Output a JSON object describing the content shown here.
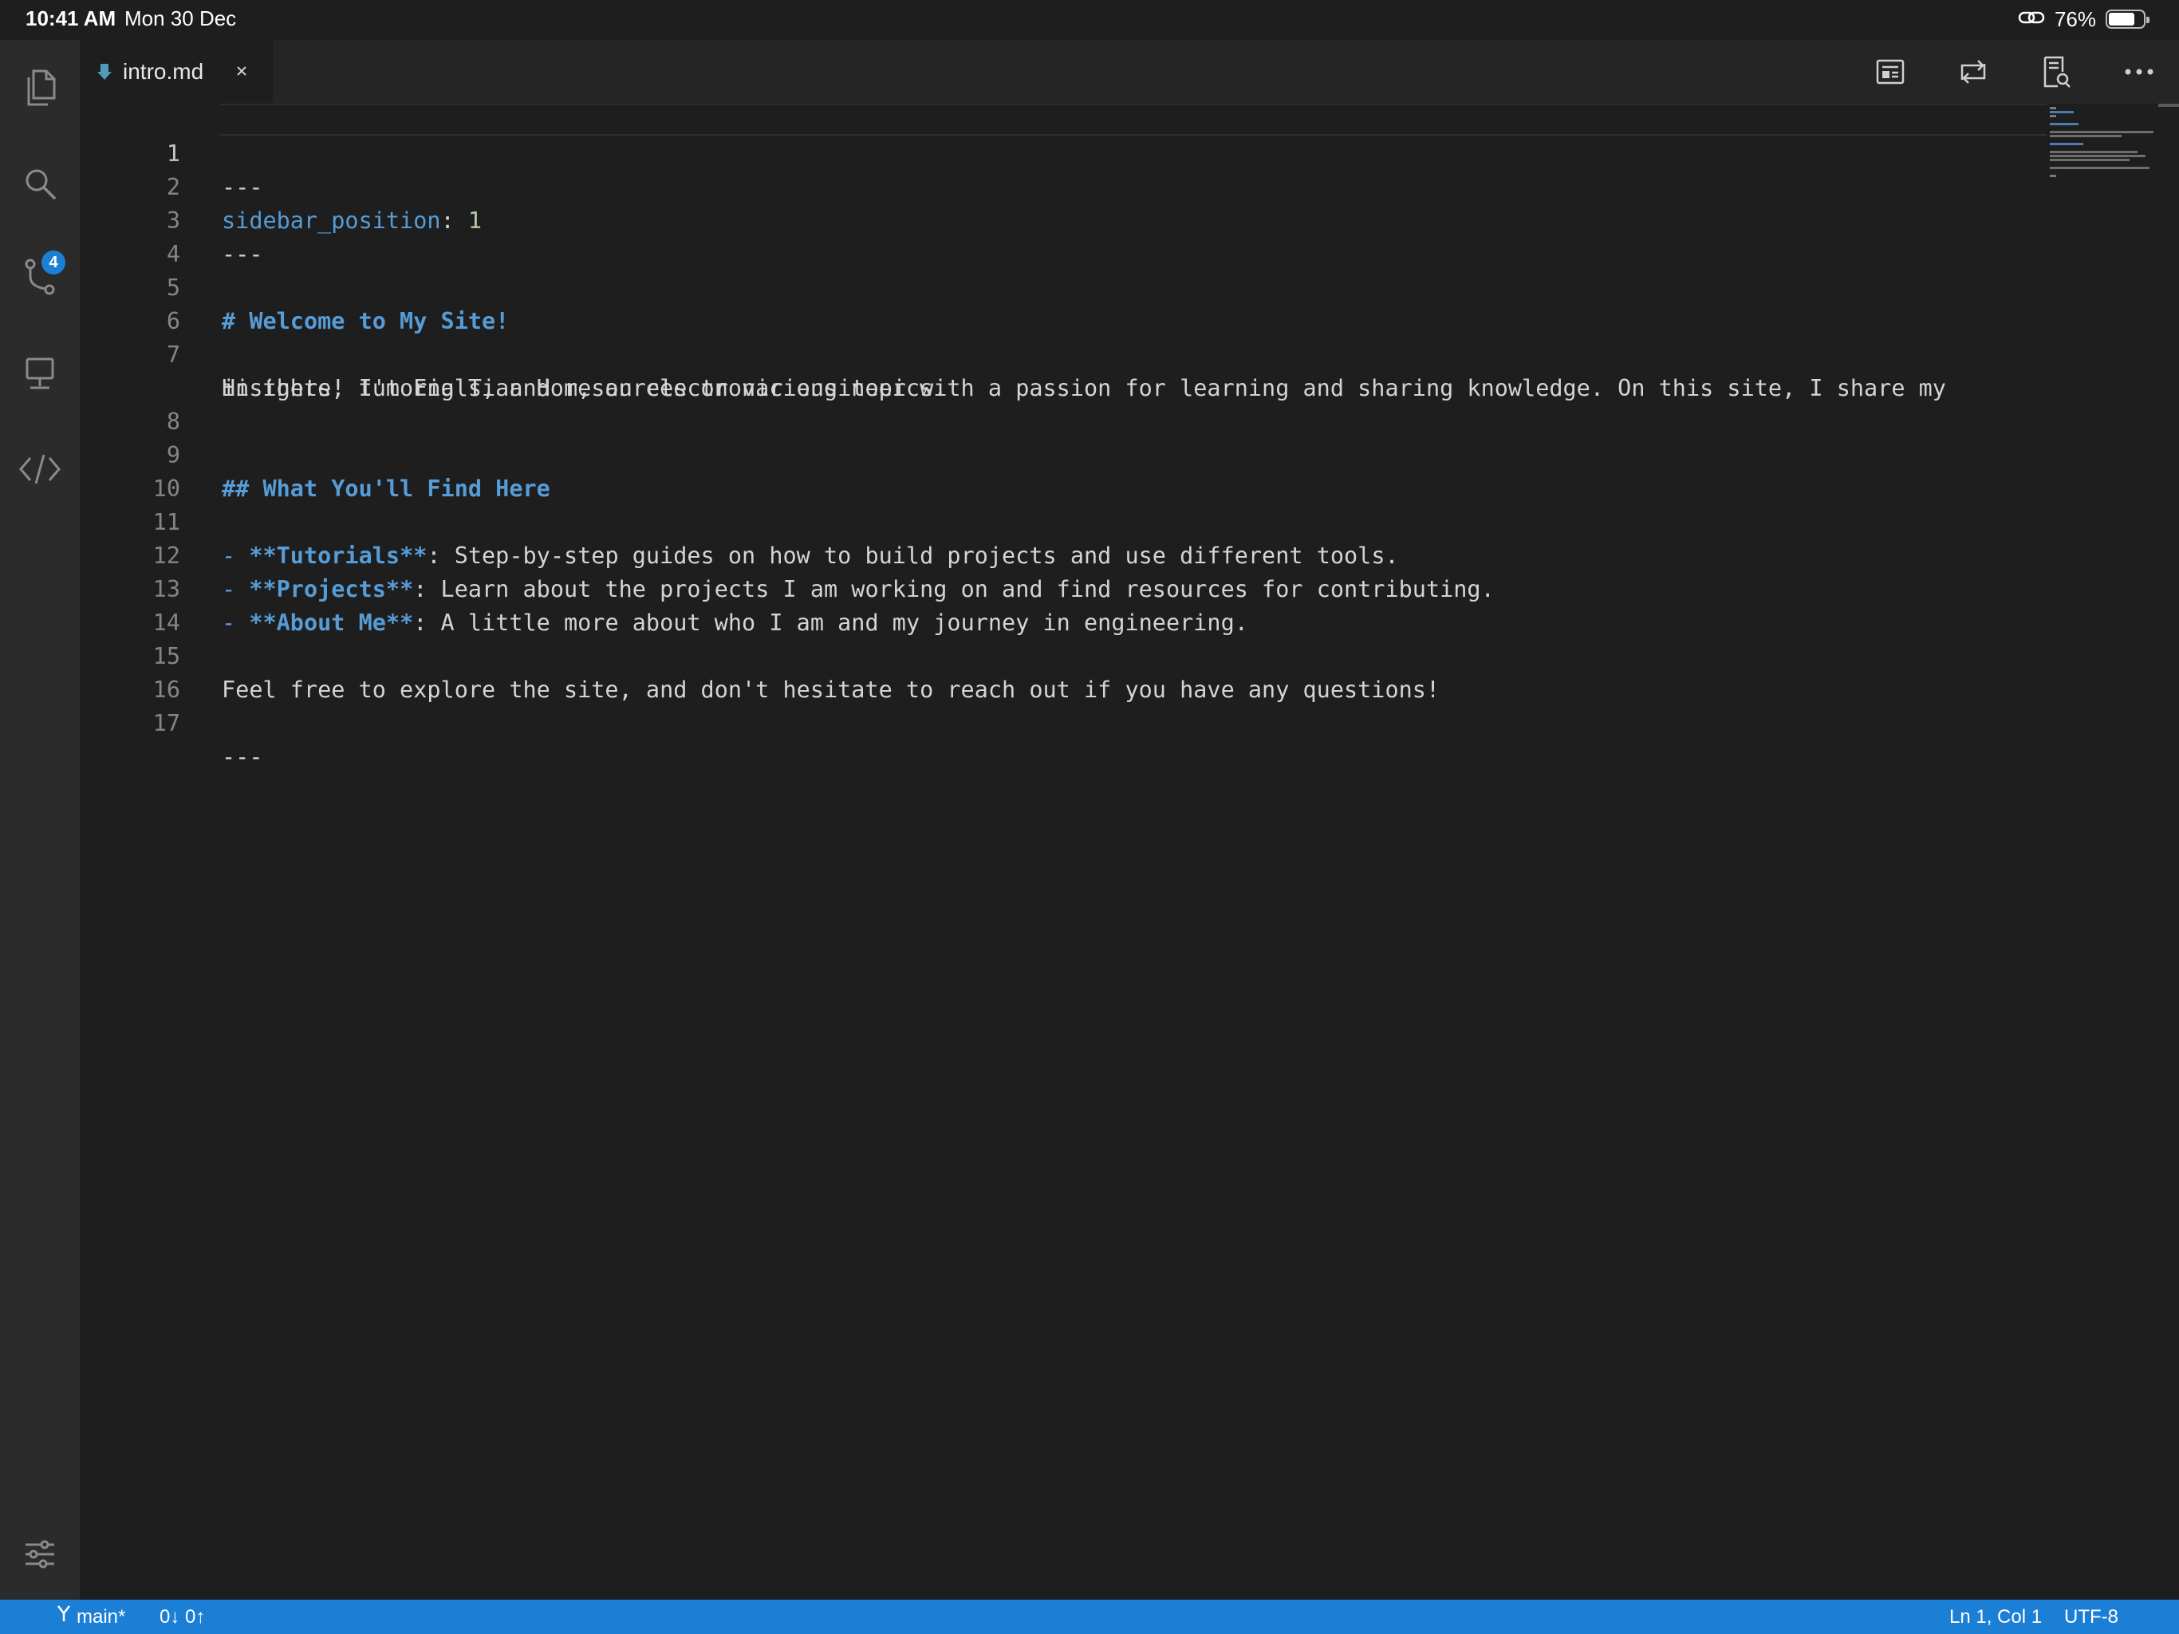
{
  "system_status": {
    "time": "10:41 AM",
    "date": "Mon 30 Dec",
    "battery_percent": "76%",
    "battery_level": 0.76
  },
  "activity_bar": {
    "items": [
      {
        "name": "explorer",
        "icon": "files-icon"
      },
      {
        "name": "search",
        "icon": "search-icon"
      },
      {
        "name": "source-control",
        "icon": "source-control-icon",
        "badge": "4"
      },
      {
        "name": "remote-explorer",
        "icon": "remote-explorer-icon"
      },
      {
        "name": "code",
        "icon": "code-icon"
      }
    ],
    "settings_icon": "settings-sliders-icon"
  },
  "tabs": [
    {
      "label": "intro.md",
      "active": true,
      "icon": "markdown-file-icon"
    }
  ],
  "toolbar": {
    "actions": [
      "open-preview-icon",
      "compare-changes-icon",
      "search-preview-icon",
      "more-actions-icon"
    ]
  },
  "editor": {
    "active_line": 1,
    "lines": [
      {
        "n": "1",
        "t": "---"
      },
      {
        "n": "2",
        "k": "sidebar_position",
        "sep": ": ",
        "v": "1"
      },
      {
        "n": "3",
        "t": "---"
      },
      {
        "n": "4",
        "t": ""
      },
      {
        "n": "5",
        "h": "# Welcome to My Site!"
      },
      {
        "n": "6",
        "t": ""
      },
      {
        "n": "7",
        "t": "Hi there! I'm Eng Tian Hom, an electronic engineer with a passion for learning and sharing knowledge. On this site, I share my",
        "t2": "insights, tutorials, and resources on various topics."
      },
      {
        "n": "8",
        "t": ""
      },
      {
        "n": "9",
        "h": "## What You'll Find Here"
      },
      {
        "n": "10",
        "t": ""
      },
      {
        "n": "11",
        "b": "- ",
        "bold": "**Tutorials**",
        "rest": ": Step-by-step guides on how to build projects and use different tools."
      },
      {
        "n": "12",
        "b": "- ",
        "bold": "**Projects**",
        "rest": ": Learn about the projects I am working on and find resources for contributing."
      },
      {
        "n": "13",
        "b": "- ",
        "bold": "**About Me**",
        "rest": ": A little more about who I am and my journey in engineering."
      },
      {
        "n": "14",
        "t": ""
      },
      {
        "n": "15",
        "t": "Feel free to explore the site, and don't hesitate to reach out if you have any questions!"
      },
      {
        "n": "16",
        "t": ""
      },
      {
        "n": "17",
        "t": "---"
      }
    ]
  },
  "status_bar": {
    "branch": "main*",
    "sync": "0↓ 0↑",
    "cursor_position": "Ln 1, Col 1",
    "encoding": "UTF-8"
  },
  "colors": {
    "accent": "#1c7fd6",
    "editor_bg": "#1e1e1e",
    "activity_bar_bg": "#2b2b2b",
    "keyword": "#569cd6",
    "number": "#b5cea8"
  }
}
